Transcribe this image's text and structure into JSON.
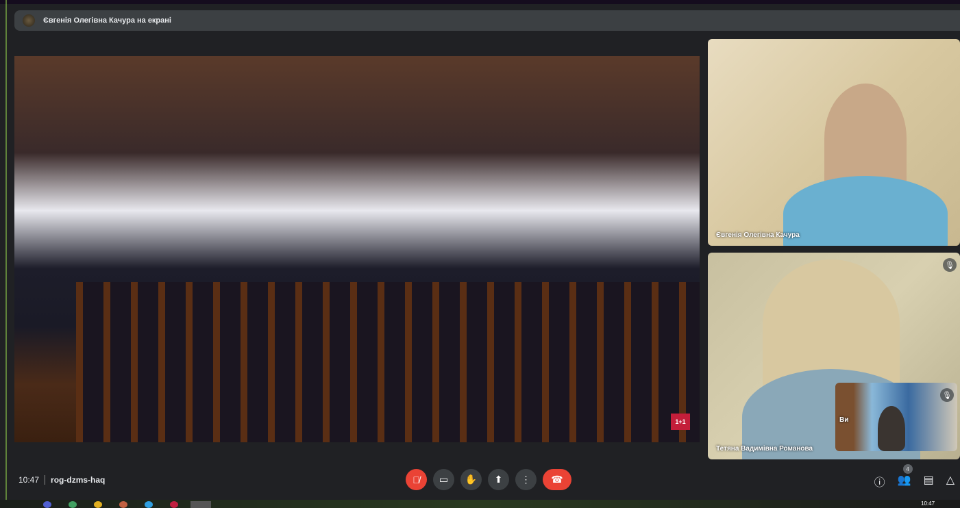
{
  "banner": {
    "text": "Євгенія Олегівна Качура на екрані"
  },
  "main_video": {
    "channel_logo": "1+1"
  },
  "participants": [
    {
      "name": "Євгенія Олегівна Качура",
      "muted": false
    },
    {
      "name": "Тетяна Вадимівна Романова",
      "muted": true
    }
  ],
  "self_view": {
    "label": "Ви",
    "muted": true
  },
  "bottom_bar": {
    "time": "10:47",
    "meeting_code": "rog-dzms-haq",
    "people_count": "4"
  },
  "controls": {
    "mic": "mic-off-icon",
    "camera": "camera-icon",
    "hand": "raise-hand-icon",
    "present": "present-icon",
    "more": "more-icon",
    "end": "end-call-icon"
  },
  "taskbar": {
    "clock": "10:47"
  },
  "colors": {
    "accent_red": "#ea4335",
    "button_bg": "#3c4043",
    "background": "#202124"
  }
}
